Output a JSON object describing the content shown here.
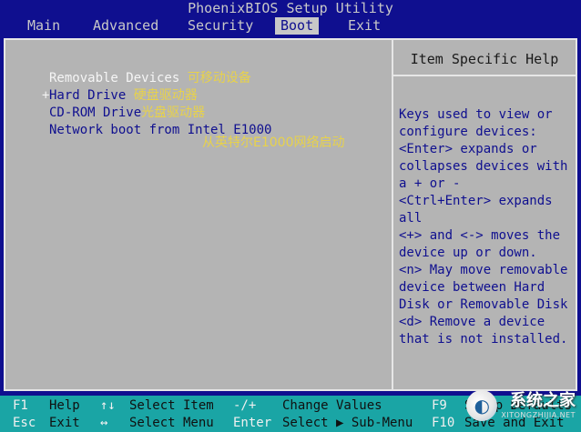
{
  "title": "PhoenixBIOS Setup Utility",
  "menu": {
    "items": [
      {
        "label": "Main"
      },
      {
        "label": "Advanced"
      },
      {
        "label": "Security"
      },
      {
        "label": "Boot"
      },
      {
        "label": "Exit"
      }
    ],
    "active": "Boot"
  },
  "boot": {
    "items": [
      {
        "marker": "",
        "label": "Removable Devices",
        "annotation": "可移动设备"
      },
      {
        "marker": "+",
        "label": "Hard Drive",
        "annotation": "硬盘驱动器"
      },
      {
        "marker": "",
        "label": "CD-ROM Drive",
        "annotation": "光盘驱动器"
      },
      {
        "marker": "",
        "label": "Network boot from Intel E1000",
        "annotation": ""
      }
    ],
    "network_annotation": "从英特尔E1000网络启动"
  },
  "help": {
    "title": "Item Specific Help",
    "lines": [
      "Keys used to view or",
      "configure devices:",
      "<Enter> expands or",
      "collapses devices with",
      "a + or -",
      "<Ctrl+Enter> expands",
      "all",
      "<+> and <-> moves the",
      "device up or down.",
      "<n> May move removable",
      "device between Hard",
      "Disk or Removable Disk",
      "<d> Remove a device",
      "that is not installed."
    ]
  },
  "footer": {
    "row1": [
      {
        "key": "F1",
        "desc": "Help"
      },
      {
        "key": "↑↓",
        "desc": "Select Item"
      },
      {
        "key": "-/+",
        "desc": "Change Values"
      },
      {
        "key": "F9",
        "desc": "Setup Defaults"
      }
    ],
    "row2": [
      {
        "key": "Esc",
        "desc": "Exit"
      },
      {
        "key": "↔",
        "desc": "Select Menu"
      },
      {
        "key": "Enter",
        "desc": "Select ▶ Sub-Menu"
      },
      {
        "key": "F10",
        "desc": "Save and Exit"
      }
    ]
  },
  "watermark": {
    "cn": "系统之家",
    "en": "XITONGZHIJIA.NET"
  },
  "colors": {
    "background": "#0f0f8f",
    "panel": "#b4b4b4",
    "footer": "#1aa5a5",
    "annotation": "#e8d24a"
  }
}
